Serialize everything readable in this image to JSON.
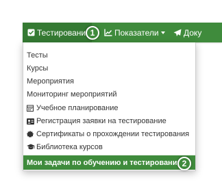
{
  "navbar": {
    "items": [
      {
        "label": "Тестирование",
        "icon": "checkbox-icon"
      },
      {
        "label": "Показатели",
        "icon": "chart-icon"
      },
      {
        "label": "Доку",
        "icon": "paper-plane-icon"
      }
    ]
  },
  "badges": {
    "first": "1",
    "second": "2"
  },
  "menu": {
    "items": [
      {
        "label": "Тесты"
      },
      {
        "label": "Курсы"
      },
      {
        "label": "Мероприятия"
      },
      {
        "label": "Мониторинг мероприятий"
      },
      {
        "label": "Учебное планирование",
        "icon": "calendar-icon"
      },
      {
        "label": "Регистрация заявки на тестирование",
        "icon": "id-card-icon"
      },
      {
        "label": "Сертификаты о прохождении тестирования",
        "icon": "certificate-icon"
      },
      {
        "label": "Библиотека курсов",
        "icon": "graduation-cap-icon"
      },
      {
        "label": "Мои задачи по обучению и тестированию"
      }
    ]
  },
  "colors": {
    "accent": "#3f8b3c",
    "accent_dark": "#357a33",
    "text": "#333333"
  }
}
